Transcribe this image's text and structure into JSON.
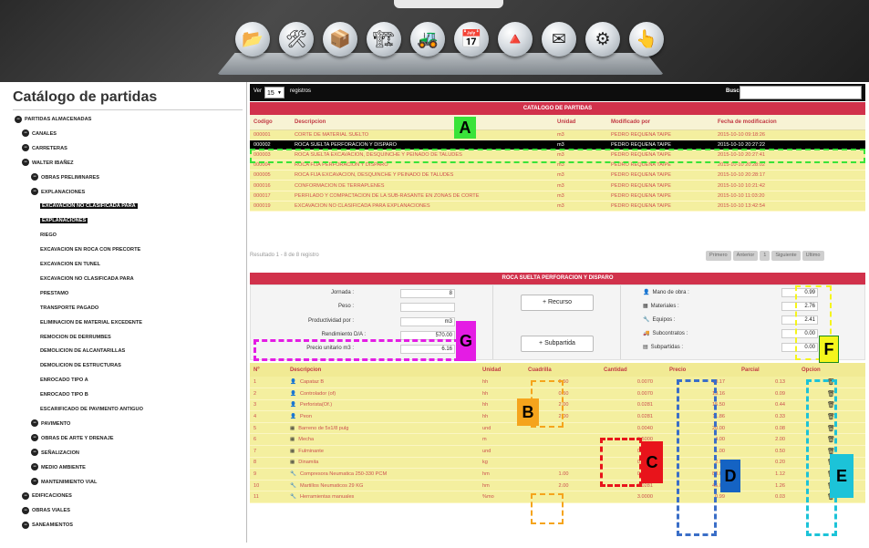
{
  "dock": {
    "icons": [
      "folder-icon",
      "tools-icon",
      "box-icon",
      "building-icon",
      "excavator-icon",
      "calendar-icon",
      "pyramid-icon",
      "mail-icon",
      "gears-icon",
      "cursor-icon"
    ]
  },
  "sidebar": {
    "title": "Catálogo de partidas",
    "tree": [
      {
        "label": "PARTIDAS ALMACENADAS",
        "level": 0,
        "icon": true
      },
      {
        "label": "CANALES",
        "level": 1,
        "icon": true
      },
      {
        "label": "CARRETERAS",
        "level": 1,
        "icon": true
      },
      {
        "label": "WALTER IBAÑEZ",
        "level": 2,
        "icon": true
      },
      {
        "label": "OBRAS PRELIMINARES",
        "level": 3,
        "icon": true
      },
      {
        "label": "EXPLANACIONES",
        "level": 3,
        "icon": true
      },
      {
        "label": "EXCAVACION NO CLASIFICADA PARA",
        "level": 4,
        "icon": false,
        "selected": true
      },
      {
        "label": "EXPLANACIONES",
        "level": 4,
        "icon": false,
        "selected": true
      },
      {
        "label": "RIEGO",
        "level": 4,
        "icon": false
      },
      {
        "label": "EXCAVACION EN ROCA CON PRECORTE",
        "level": 4,
        "icon": false
      },
      {
        "label": "EXCAVACION EN TUNEL",
        "level": 4,
        "icon": false
      },
      {
        "label": "EXCAVACION NO CLASIFICADA PARA",
        "level": 4,
        "icon": false
      },
      {
        "label": "PRESTAMO",
        "level": 4,
        "icon": false
      },
      {
        "label": "TRANSPORTE PAGADO",
        "level": 4,
        "icon": false
      },
      {
        "label": "ELIMINACION DE MATERIAL EXCEDENTE",
        "level": 4,
        "icon": false
      },
      {
        "label": "REMOCION DE DERRUMBES",
        "level": 4,
        "icon": false
      },
      {
        "label": "DEMOLICION DE ALCANTARILLAS",
        "level": 4,
        "icon": false
      },
      {
        "label": "DEMOLICION DE ESTRUCTURAS",
        "level": 4,
        "icon": false
      },
      {
        "label": "ENROCADO TIPO A",
        "level": 4,
        "icon": false
      },
      {
        "label": "ENROCADO TIPO B",
        "level": 4,
        "icon": false
      },
      {
        "label": "ESCARIFICADO DE PAVIMENTO ANTIGUO",
        "level": 4,
        "icon": false
      },
      {
        "label": "PAVIMENTO",
        "level": 3,
        "icon": true
      },
      {
        "label": "OBRAS DE ARTE Y DRENAJE",
        "level": 3,
        "icon": true
      },
      {
        "label": "SEÑALIZACION",
        "level": 3,
        "icon": true
      },
      {
        "label": "MEDIO AMBIENTE",
        "level": 3,
        "icon": true
      },
      {
        "label": "MANTENIMIENTO VIAL",
        "level": 3,
        "icon": true
      },
      {
        "label": "EDIFICACIONES",
        "level": 1,
        "icon": true
      },
      {
        "label": "OBRAS VIALES",
        "level": 1,
        "icon": true
      },
      {
        "label": "SANEAMIENTOS",
        "level": 1,
        "icon": true
      }
    ]
  },
  "toolbar": {
    "show_label": "Ver",
    "page_size": "15",
    "records_label": "registros",
    "search_label": "Buscar :",
    "search_value": ""
  },
  "catalog": {
    "title": "CATALOGO DE PARTIDAS",
    "headers": [
      "Codigo",
      "Descripcion",
      "Unidad",
      "Modificado por",
      "Fecha de modificacion"
    ],
    "rows": [
      [
        "000001",
        "CORTE DE MATERIAL SUELTO",
        "m3",
        "PEDRO REQUENA TAIPE",
        "2015-10-10 09:18:26"
      ],
      [
        "000002",
        "ROCA SUELTA PERFORACION Y DISPARO",
        "m3",
        "PEDRO REQUENA TAIPE",
        "2015-10-10 20:27:22"
      ],
      [
        "000003",
        "ROCA SUELTA EXCAVACION, DESQUINCHE Y PEINADO DE TALUDES",
        "m3",
        "PEDRO REQUENA TAIPE",
        "2015-10-10 20:27:41"
      ],
      [
        "000004",
        "ROCA FIJA PERFORACION Y DISPARO",
        "m3",
        "PEDRO REQUENA TAIPE",
        "2015-10-10 20:28:02"
      ],
      [
        "000005",
        "ROCA FIJA EXCAVACION, DESQUINCHE Y PEINADO DE TALUDES",
        "m3",
        "PEDRO REQUENA TAIPE",
        "2015-10-10 20:28:17"
      ],
      [
        "000016",
        "CONFORMACION DE TERRAPLENES",
        "m3",
        "PEDRO REQUENA TAIPE",
        "2015-10-10 10:21:42"
      ],
      [
        "000017",
        "PERFILADO Y COMPACTACION DE LA SUB-RASANTE EN ZONAS DE CORTE",
        "m3",
        "PEDRO REQUENA TAIPE",
        "2015-10-10 11:03:20"
      ],
      [
        "000019",
        "EXCAVACION NO CLASIFICADA PARA EXPLANACIONES",
        "m3",
        "PEDRO REQUENA TAIPE",
        "2015-10-10 13:42:54"
      ]
    ],
    "selected_index": 1,
    "info": "Resultado 1 - 8 de 8 registro",
    "pager": [
      "Primero",
      "Anterior",
      "1",
      "Siguiente",
      "Ultimo"
    ]
  },
  "detail": {
    "title": "ROCA SUELTA PERFORACION Y DISPARO",
    "form": {
      "jornada_label": "Jornada :",
      "jornada": "8",
      "peso_label": "Peso :",
      "peso": "",
      "prod_label": "Productividad por :",
      "prod": "m3",
      "rend_label": "Rendimiento D/A :",
      "rend": "570.00",
      "precio_label": "Precio unitario m3 :",
      "precio": "6.16",
      "recurso_btn": "+ Recurso",
      "subpartida_btn": "+ Subpartida"
    },
    "resources": [
      {
        "icon": "person-icon",
        "label": "Mano de obra :",
        "value": "0.99"
      },
      {
        "icon": "materials-icon",
        "label": "Materiales :",
        "value": "2.76"
      },
      {
        "icon": "wrench-icon",
        "label": "Equipos :",
        "value": "2.41"
      },
      {
        "icon": "truck-icon",
        "label": "Subcontratos :",
        "value": "0.00"
      },
      {
        "icon": "table-icon",
        "label": "Subpartidas :",
        "value": "0.00"
      }
    ],
    "headers": [
      "Nº",
      "Descripcion",
      "Unidad",
      "Cuadrilla",
      "Cantidad",
      "Precio",
      "Parcial",
      "Opcion"
    ],
    "rows": [
      [
        "1",
        "Capataz B",
        "hh",
        "0.50",
        "0.0070",
        "18.17",
        "0.13"
      ],
      [
        "2",
        "Controlador (of)",
        "hh",
        "0.50",
        "0.0070",
        "13.16",
        "0.09"
      ],
      [
        "3",
        "Perforista(Of.)",
        "hh",
        "2.00",
        "0.0281",
        "15.50",
        "0.44"
      ],
      [
        "4",
        "Peon",
        "hh",
        "2.00",
        "0.0281",
        "11.86",
        "0.33"
      ],
      [
        "5",
        "Barreno de 5x1/8 pulg",
        "und",
        "",
        "0.0040",
        "20.00",
        "0.08"
      ],
      [
        "6",
        "Mecha",
        "m",
        "",
        "0.5000",
        "4.00",
        "2.00"
      ],
      [
        "7",
        "Fulminante",
        "und",
        "",
        "0.5000",
        "1.00",
        "0.50"
      ],
      [
        "8",
        "Dinamita",
        "kg",
        "",
        "0.1000",
        "2.00",
        "0.20"
      ],
      [
        "9",
        "Compresora Neumatica 250-330 PCM",
        "hm",
        "1.00",
        "0.0140",
        "80.00",
        "1.12"
      ],
      [
        "10",
        "Martillos Neumaticos 29 KG",
        "hm",
        "2.00",
        "0.0281",
        "45.00",
        "1.26"
      ],
      [
        "11",
        "Herramientas manuales",
        "%mo",
        "",
        "3.0000",
        "0.99",
        "0.03"
      ]
    ],
    "row_icons": [
      "person-icon",
      "person-icon",
      "person-icon",
      "person-icon",
      "materials-icon",
      "materials-icon",
      "materials-icon",
      "materials-icon",
      "wrench-icon",
      "wrench-icon",
      "wrench-icon"
    ]
  },
  "annotations": {
    "A": "A",
    "B": "B",
    "C": "C",
    "D": "D",
    "E": "E",
    "F": "F",
    "G": "G",
    "colors": {
      "A": "#39e339",
      "B": "#f5a41c",
      "C": "#e8141b",
      "D": "#1563c3",
      "E": "#1cc3d8",
      "F": "#f5f51c",
      "G": "#e41ce4"
    }
  },
  "colors": {
    "accent": "#d1314b",
    "row_bg": "#f4ef9f",
    "header_text": "#c23a44"
  }
}
